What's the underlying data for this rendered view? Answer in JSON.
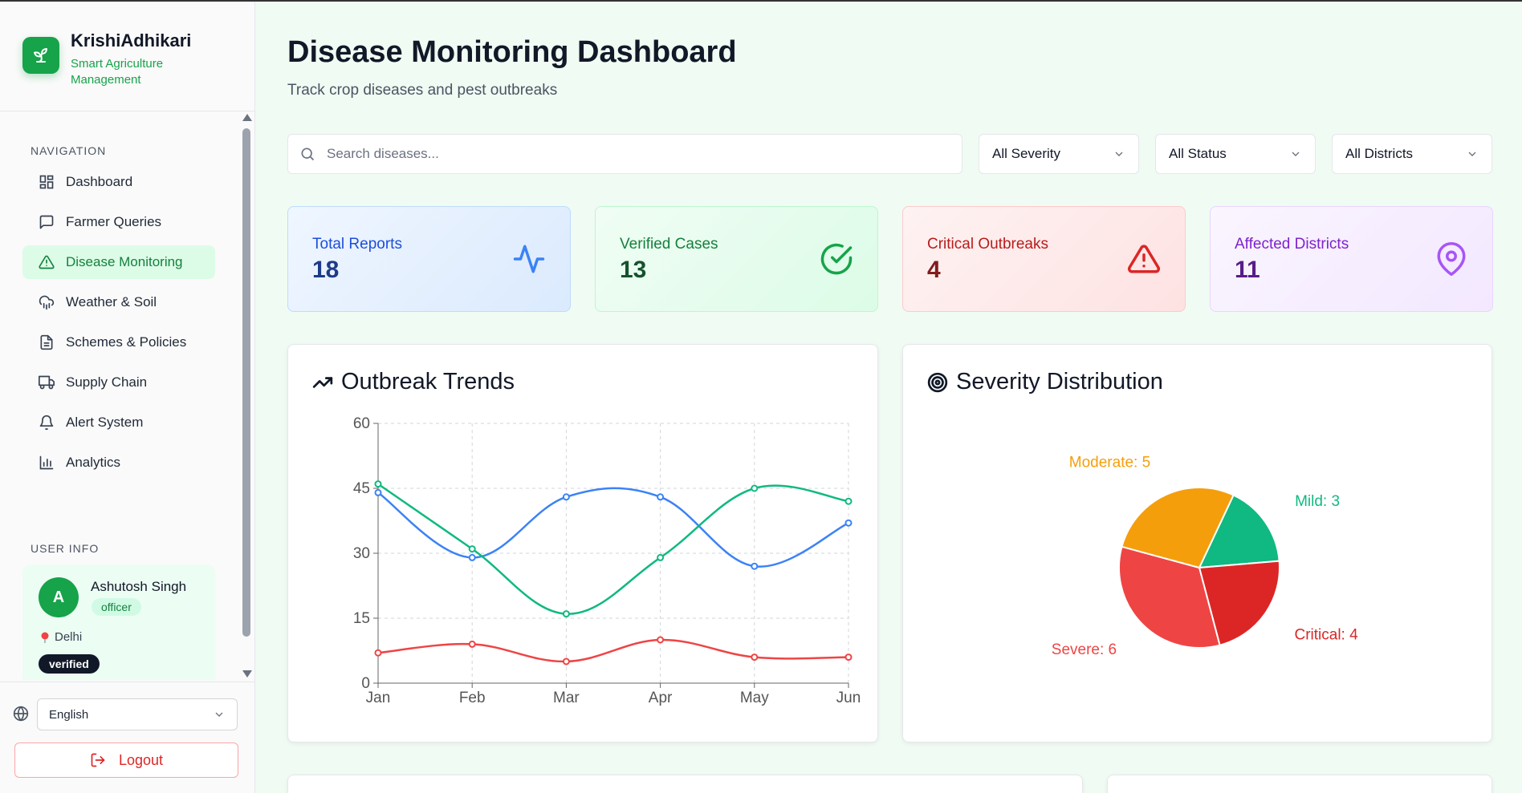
{
  "app": {
    "name": "KrishiAdhikari",
    "tagline": "Smart Agriculture Management"
  },
  "sidebar": {
    "nav_heading": "NAVIGATION",
    "items": [
      {
        "label": "Dashboard",
        "icon": "grid-icon",
        "active": false
      },
      {
        "label": "Farmer Queries",
        "icon": "message-icon",
        "active": false
      },
      {
        "label": "Disease Monitoring",
        "icon": "alert-triangle-icon",
        "active": true
      },
      {
        "label": "Weather & Soil",
        "icon": "cloud-rain-icon",
        "active": false
      },
      {
        "label": "Schemes & Policies",
        "icon": "file-text-icon",
        "active": false
      },
      {
        "label": "Supply Chain",
        "icon": "truck-icon",
        "active": false
      },
      {
        "label": "Alert System",
        "icon": "bell-icon",
        "active": false
      },
      {
        "label": "Analytics",
        "icon": "bar-chart-icon",
        "active": false
      }
    ],
    "user_heading": "USER INFO",
    "user": {
      "initial": "A",
      "name": "Ashutosh Singh",
      "role": "officer",
      "location": "Delhi",
      "status": "verified"
    },
    "language": "English",
    "logout_label": "Logout"
  },
  "header": {
    "title": "Disease Monitoring Dashboard",
    "subtitle": "Track crop diseases and pest outbreaks"
  },
  "filters": {
    "search_placeholder": "Search diseases...",
    "severity": "All Severity",
    "status": "All Status",
    "district": "All Districts"
  },
  "stats": [
    {
      "label": "Total Reports",
      "value": "18",
      "icon": "activity-icon",
      "color": "#3b82f6"
    },
    {
      "label": "Verified Cases",
      "value": "13",
      "icon": "check-circle-icon",
      "color": "#16a34a"
    },
    {
      "label": "Critical Outbreaks",
      "value": "4",
      "icon": "alert-triangle-icon",
      "color": "#dc2626"
    },
    {
      "label": "Affected Districts",
      "value": "11",
      "icon": "map-pin-icon",
      "color": "#a855f7"
    }
  ],
  "trend_card": {
    "title": "Outbreak Trends",
    "icon": "trending-up-icon"
  },
  "severity_card": {
    "title": "Severity Distribution",
    "icon": "target-icon"
  },
  "chart_data": [
    {
      "type": "line",
      "title": "Outbreak Trends",
      "categories": [
        "Jan",
        "Feb",
        "Mar",
        "Apr",
        "May",
        "Jun"
      ],
      "yticks": [
        "0",
        "15",
        "30",
        "45",
        "60"
      ],
      "ylim": [
        0,
        60
      ],
      "grid": true,
      "series": [
        {
          "color": "#3b82f6",
          "values": [
            44,
            29,
            43,
            43,
            27,
            37
          ]
        },
        {
          "color": "#10b981",
          "values": [
            46,
            31,
            16,
            29,
            45,
            42
          ]
        },
        {
          "color": "#ef4444",
          "values": [
            7,
            9,
            5,
            10,
            6,
            6
          ]
        }
      ]
    },
    {
      "type": "pie",
      "title": "Severity Distribution",
      "slices": [
        {
          "label": "Mild: 3",
          "value": 3,
          "color": "#10b981"
        },
        {
          "label": "Critical: 4",
          "value": 4,
          "color": "#dc2626"
        },
        {
          "label": "Severe: 6",
          "value": 6,
          "color": "#ef4444"
        },
        {
          "label": "Moderate: 5",
          "value": 5,
          "color": "#f59e0b"
        }
      ]
    }
  ]
}
